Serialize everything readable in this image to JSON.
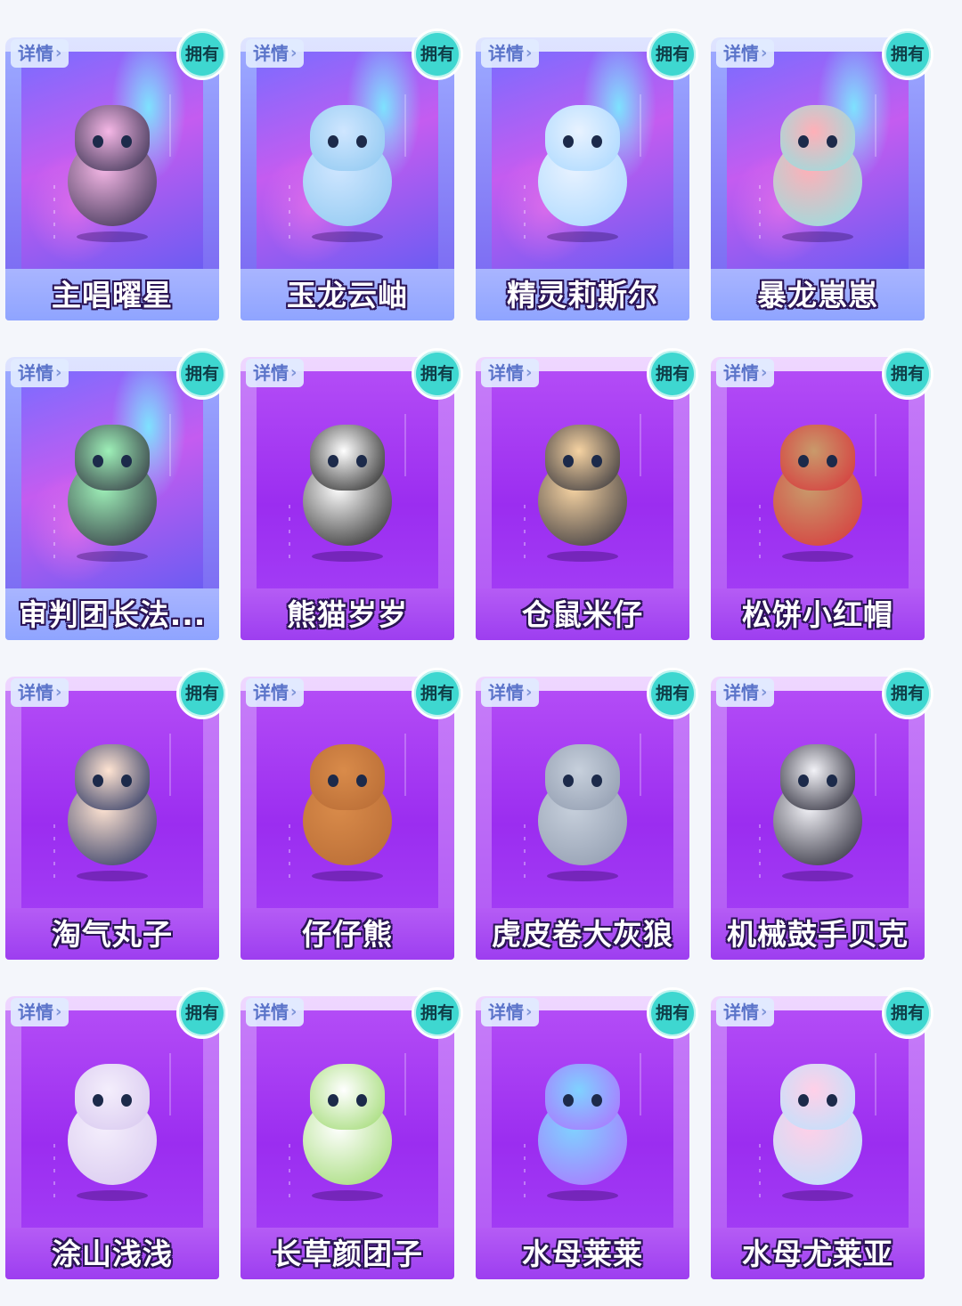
{
  "labels": {
    "detail": "详情",
    "owned": "拥有",
    "chevron": "›"
  },
  "items": [
    {
      "name": "主唱曜星",
      "theme": "holo",
      "figure_colors": [
        "#f5b7e6",
        "#2a2746"
      ]
    },
    {
      "name": "玉龙云岫",
      "theme": "holo",
      "figure_colors": [
        "#cfe6ff",
        "#8cc7f0"
      ]
    },
    {
      "name": "精灵莉斯尔",
      "theme": "holo",
      "figure_colors": [
        "#e8f2ff",
        "#a7d7ff"
      ]
    },
    {
      "name": "暴龙崽崽",
      "theme": "holo",
      "figure_colors": [
        "#ffb0b8",
        "#8be4e4"
      ]
    },
    {
      "name": "审判团长法...",
      "theme": "holo",
      "figure_colors": [
        "#9ef0b8",
        "#2b2a3a"
      ]
    },
    {
      "name": "熊猫岁岁",
      "theme": "purple",
      "figure_colors": [
        "#ffffff",
        "#1b1b1b"
      ]
    },
    {
      "name": "仓鼠米仔",
      "theme": "purple",
      "figure_colors": [
        "#f6d3a2",
        "#2a2b35"
      ]
    },
    {
      "name": "松饼小红帽",
      "theme": "purple",
      "figure_colors": [
        "#c99a6b",
        "#d8333a"
      ]
    },
    {
      "name": "淘气丸子",
      "theme": "purple",
      "figure_colors": [
        "#ffe4d2",
        "#1d2a5a"
      ]
    },
    {
      "name": "仔仔熊",
      "theme": "purple",
      "figure_colors": [
        "#d98b4a",
        "#b66a34"
      ]
    },
    {
      "name": "虎皮卷大灰狼",
      "theme": "purple",
      "figure_colors": [
        "#c7d0dc",
        "#8e99ad"
      ]
    },
    {
      "name": "机械鼓手贝克",
      "theme": "purple",
      "figure_colors": [
        "#f2f2f7",
        "#1c1b2a"
      ]
    },
    {
      "name": "涂山浅浅",
      "theme": "purple",
      "figure_colors": [
        "#f4eefc",
        "#d7c7ef"
      ]
    },
    {
      "name": "长草颜团子",
      "theme": "purple",
      "figure_colors": [
        "#ffffff",
        "#9bd86b"
      ]
    },
    {
      "name": "水母莱莱",
      "theme": "purple",
      "figure_colors": [
        "#7fd2ff",
        "#b06dff"
      ]
    },
    {
      "name": "水母尤莱亚",
      "theme": "purple",
      "figure_colors": [
        "#ffd0e8",
        "#b8e3ff"
      ]
    }
  ]
}
